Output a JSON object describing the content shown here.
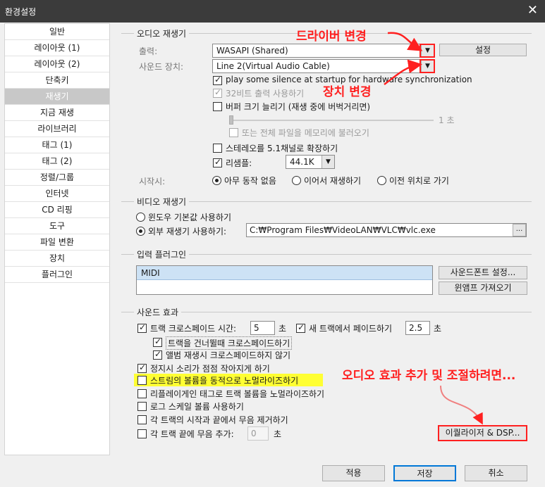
{
  "window": {
    "title": "환경설정",
    "close_glyph": "✕"
  },
  "sidebar": {
    "items": [
      {
        "label": "일반"
      },
      {
        "label": "레이아웃 (1)"
      },
      {
        "label": "레이아웃 (2)"
      },
      {
        "label": "단축키"
      },
      {
        "label": "재생기"
      },
      {
        "label": "지금 재생"
      },
      {
        "label": "라이브러리"
      },
      {
        "label": "태그 (1)"
      },
      {
        "label": "태그 (2)"
      },
      {
        "label": "정렬/그룹"
      },
      {
        "label": "인터넷"
      },
      {
        "label": "CD 리핑"
      },
      {
        "label": "도구"
      },
      {
        "label": "파일 변환"
      },
      {
        "label": "장치"
      },
      {
        "label": "플러그인"
      }
    ],
    "selected": "재생기"
  },
  "audio_player": {
    "section_title": "오디오 재생기",
    "output_label": "출력:",
    "output_value": "WASAPI (Shared)",
    "settings_button": "설정",
    "sound_device_label": "사운드 장치:",
    "sound_device_value": "Line 2(Virtual Audio Cable)",
    "play_silence_label": "play some silence at startup for hardware synchronization",
    "play_silence_checked": true,
    "bit32_label": "32비트 출력 사용하기",
    "bit32_checked": true,
    "buffer_label": "버퍼 크기 늘리기 (재생 중에 버벅거리면)",
    "buffer_checked": false,
    "buffer_value": "1 초",
    "buffer_level": 0.0,
    "whole_file_label": "또는 전체 파일을 메모리에 불러오기",
    "stereo_label": "스테레오를 5.1채널로 확장하기",
    "stereo_checked": false,
    "resample_label": "리샘플:",
    "resample_checked": true,
    "resample_value": "44.1K",
    "startup_label": "시작시:",
    "startup_options": [
      "아무 동작 없음",
      "이어서 재생하기",
      "이전 위치로 가기"
    ],
    "startup_selected": "아무 동작 없음"
  },
  "video_player": {
    "section_title": "비디오 재생기",
    "default_window_label": "윈도우 기본값 사용하기",
    "external_label": "외부 재생기 사용하기:",
    "external_path": "C:₩Program Files₩VideoLAN₩VLC₩vlc.exe",
    "browse_label": "..."
  },
  "input_plugins": {
    "section_title": "입력 플러그인",
    "items": [
      "MIDI"
    ],
    "soundfont_button": "사운드폰트 설정...",
    "winamp_button": "윈앰프 가져오기"
  },
  "sound_effects": {
    "section_title": "사운드 효과",
    "crossfade_label": "트랙 크로스페이드 시간:",
    "crossfade_checked": true,
    "crossfade_value": "5",
    "crossfade_unit": "초",
    "new_track_fade_label": "새 트랙에서 페이드하기",
    "new_track_fade_checked": true,
    "new_track_fade_value": "2.5",
    "new_track_fade_unit": "초",
    "skip_crossfade_label": "트랙을 건너뛸때 크로스페이드하기",
    "skip_crossfade_checked": true,
    "no_album_crossfade_label": "앨범 재생시 크로스페이드하지 않기",
    "no_album_crossfade_checked": true,
    "fade_on_stop_label": "정지시 소리가 점점 작아지게 하기",
    "fade_on_stop_checked": true,
    "normalize_stream_label": "스트림의 볼륨을 동적으로 노멀라이즈하기",
    "normalize_stream_checked": false,
    "replaygain_label": "리플레이게인 태그로 트랙 볼륨을 노멀라이즈하기",
    "replaygain_checked": false,
    "log_scale_label": "로그 스케일 볼륨 사용하기",
    "log_scale_checked": false,
    "remove_silence_label": "각 트랙의 시작과 끝에서 무음 제거하기",
    "remove_silence_checked": false,
    "add_silence_label": "각 트랙 끝에 무음 추가:",
    "add_silence_checked": false,
    "add_silence_value": "0",
    "add_silence_unit": "초",
    "eq_dsp_button": "이퀄라이저 & DSP..."
  },
  "footer": {
    "apply": "적용",
    "save": "저장",
    "cancel": "취소"
  },
  "annotations": {
    "driver_change": "드라이버 변경",
    "device_change": "장치 변경",
    "effects_hint": "오디오 효과 추가 및 조절하려면...",
    "color": "#ff2020",
    "highlight_color": "#ffff33"
  }
}
